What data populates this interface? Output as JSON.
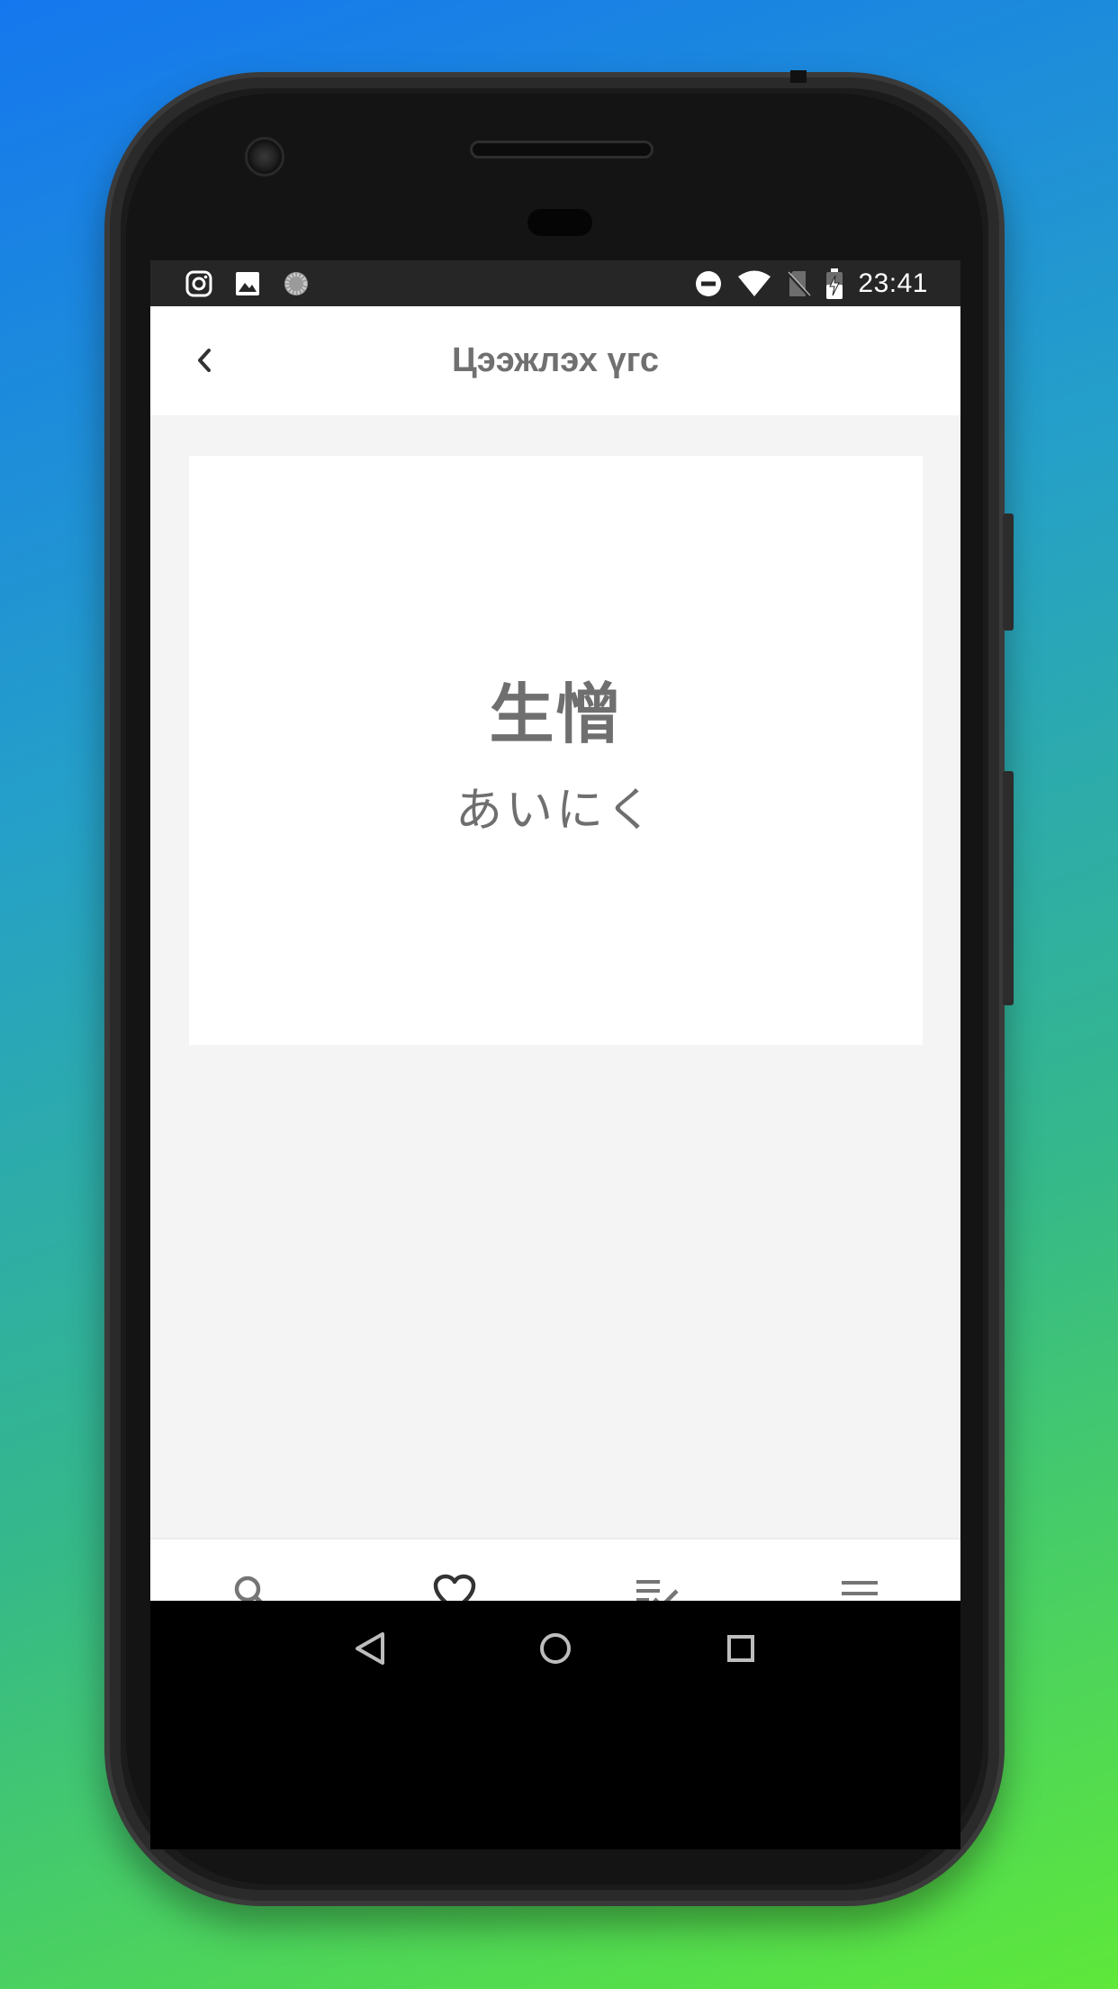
{
  "status_bar": {
    "time": "23:41",
    "left_icons": [
      "instagram-icon",
      "image-icon",
      "loading-icon"
    ],
    "right_icons": [
      "do-not-disturb-icon",
      "wifi-icon",
      "no-sim-icon",
      "battery-charging-icon"
    ]
  },
  "app_bar": {
    "title": "Цээжлэх үгс",
    "back_icon": "chevron-left-icon"
  },
  "word_card": {
    "kanji": "生憎",
    "reading": "あいにく"
  },
  "bottom_nav": {
    "items": [
      {
        "icon": "search-icon",
        "active": false
      },
      {
        "icon": "heart-icon",
        "active": true
      },
      {
        "icon": "checklist-icon",
        "active": false
      },
      {
        "icon": "menu-icon",
        "active": false
      }
    ]
  },
  "system_nav": {
    "items": [
      "back-triangle-icon",
      "home-circle-icon",
      "recents-square-icon"
    ]
  },
  "colors": {
    "background_top": "#1577ee",
    "background_bottom": "#5ee83a",
    "title_gray": "#707070",
    "screen_bg": "#f4f4f4",
    "icon_gray": "#757575",
    "icon_active": "#333333"
  }
}
